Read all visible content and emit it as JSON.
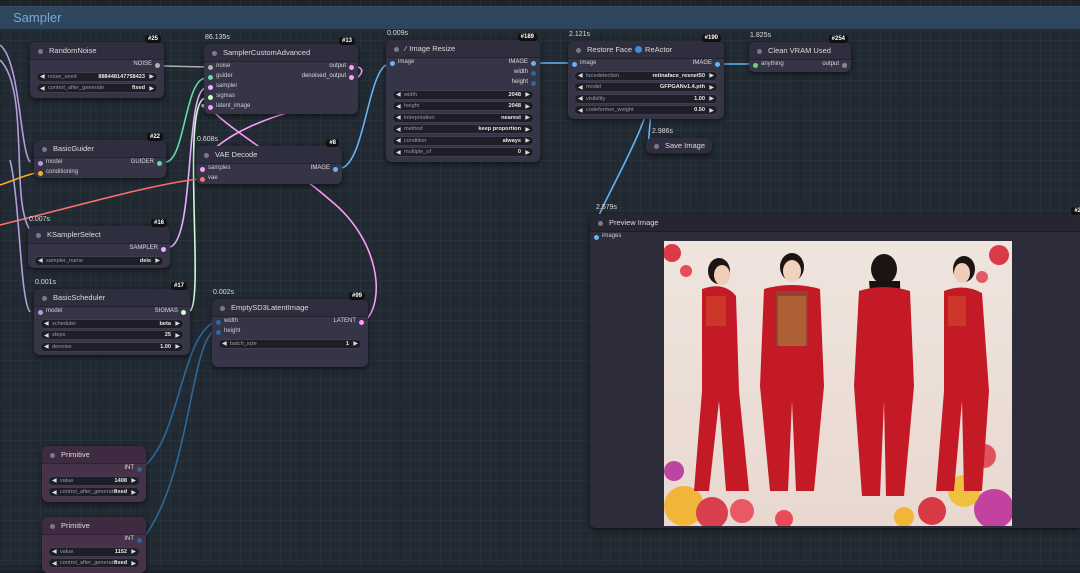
{
  "group": {
    "title": "Sampler"
  },
  "colors": {
    "noise": "#b0b0b0",
    "guider": "#66d9a8",
    "sampler": "#e6b0ff",
    "sigmas": "#cdffcd",
    "latent": "#ff9cf9",
    "image": "#64b5f6",
    "vae": "#ff6e6e",
    "int": "#29699c",
    "model": "#b39ddb",
    "conditioning": "#ffa931"
  },
  "nodes": {
    "random_noise": {
      "title": "RandomNoise",
      "id": "#25",
      "output": "NOISE",
      "widgets": [
        {
          "label": "noise_seed",
          "value": "888448147758423"
        },
        {
          "label": "control_after_generate",
          "value": "fixed"
        }
      ]
    },
    "sampler_custom": {
      "title": "SamplerCustomAdvanced",
      "id": "#13",
      "timing": "86.135s",
      "inputs": [
        "noise",
        "guider",
        "sampler",
        "sigmas",
        "latent_image"
      ],
      "outputs": [
        "output",
        "denoised_output"
      ]
    },
    "image_resize": {
      "title": "Image Resize",
      "id": "#189",
      "timing": "0.009s",
      "inputs": [
        "image"
      ],
      "outputs": [
        "IMAGE",
        "width",
        "height"
      ],
      "widgets": [
        {
          "label": "width",
          "value": "2048"
        },
        {
          "label": "height",
          "value": "2048"
        },
        {
          "label": "interpolation",
          "value": "nearest"
        },
        {
          "label": "method",
          "value": "keep proportion"
        },
        {
          "label": "condition",
          "value": "always"
        },
        {
          "label": "multiple_of",
          "value": "0"
        }
      ]
    },
    "restore_face": {
      "title": "Restore Face",
      "title_suffix": "ReActor",
      "id": "#190",
      "timing": "2.121s",
      "inputs": [
        "image"
      ],
      "outputs": [
        "IMAGE"
      ],
      "widgets": [
        {
          "label": "facedetection",
          "value": "retinaface_resnet50"
        },
        {
          "label": "model",
          "value": "GFPGANv1.4.pth"
        },
        {
          "label": "visibility",
          "value": "1.00"
        },
        {
          "label": "codeformer_weight",
          "value": "0.50"
        }
      ]
    },
    "clean_vram": {
      "title": "Clean VRAM Used",
      "id": "#254",
      "timing": "1.825s",
      "inputs": [
        "anything"
      ],
      "outputs": [
        "output"
      ]
    },
    "save_image": {
      "title": "Save Image",
      "timing": "2.986s"
    },
    "basic_guider": {
      "title": "BasicGuider",
      "id": "#22",
      "inputs": [
        "model",
        "conditioning"
      ],
      "outputs": [
        "GUIDER"
      ]
    },
    "vae_decode": {
      "title": "VAE Decode",
      "id": "#8",
      "timing": "0.608s",
      "inputs": [
        "samples",
        "vae"
      ],
      "outputs": [
        "IMAGE"
      ]
    },
    "ksampler_select": {
      "title": "KSamplerSelect",
      "id": "#16",
      "timing": "0.007s",
      "outputs": [
        "SAMPLER"
      ],
      "widgets": [
        {
          "label": "sampler_name",
          "value": "deis"
        }
      ]
    },
    "basic_scheduler": {
      "title": "BasicScheduler",
      "id": "#17",
      "timing": "0.001s",
      "inputs": [
        "model"
      ],
      "outputs": [
        "SIGMAS"
      ],
      "widgets": [
        {
          "label": "scheduler",
          "value": "beta"
        },
        {
          "label": "steps",
          "value": "25"
        },
        {
          "label": "denoise",
          "value": "1.00"
        }
      ]
    },
    "empty_latent": {
      "title": "EmptySD3LatentImage",
      "id": "#99",
      "timing": "0.002s",
      "inputs": [
        "width",
        "height"
      ],
      "outputs": [
        "LATENT"
      ],
      "widgets": [
        {
          "label": "batch_size",
          "value": "1"
        }
      ]
    },
    "preview_image": {
      "title": "Preview Image",
      "id": "#2",
      "timing": "2.579s",
      "inputs": [
        "images"
      ]
    },
    "primitive_1": {
      "title": "Primitive",
      "output": "INT",
      "widgets": [
        {
          "label": "value",
          "value": "1408"
        },
        {
          "label": "control_after_generate",
          "value": "fixed"
        }
      ]
    },
    "primitive_2": {
      "title": "Primitive",
      "output": "INT",
      "widgets": [
        {
          "label": "value",
          "value": "1152"
        },
        {
          "label": "control_after_generate",
          "value": "fixed"
        }
      ]
    }
  }
}
